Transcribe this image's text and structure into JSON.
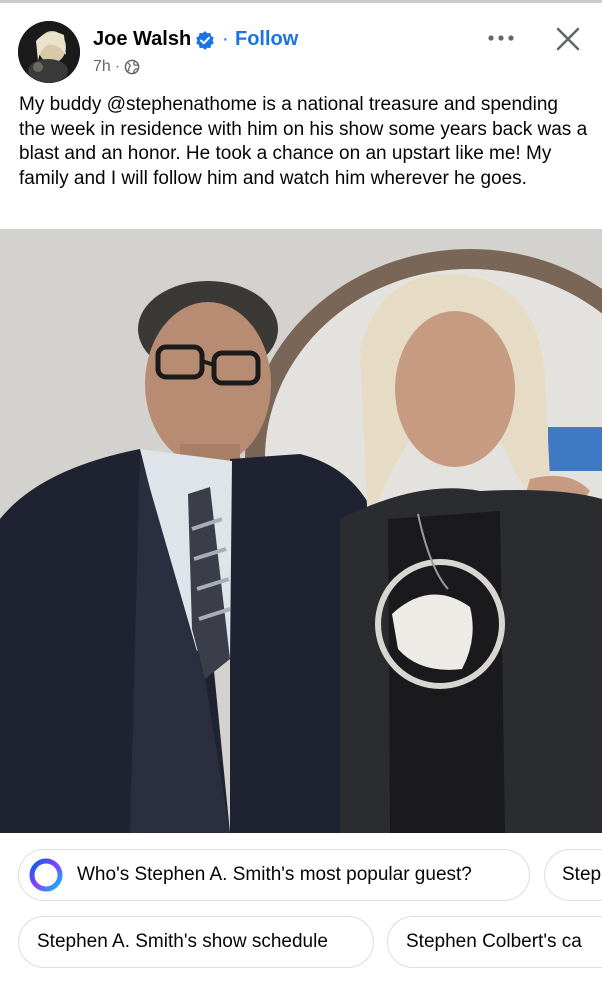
{
  "post": {
    "author": "Joe Walsh",
    "follow_label": "Follow",
    "separator": "·",
    "time": "7h",
    "time_separator": "·",
    "caption": "My buddy @stephenathome is a national treasure and spending the week in residence with him on his show some years back was a blast and an honor. He took a chance on an upstart like me! My family and I will follow him and watch him wherever he goes."
  },
  "icons": {
    "verified": "verified-badge-icon",
    "globe": "globe-icon",
    "more": "more-options-icon",
    "close": "close-icon"
  },
  "suggestions": [
    {
      "label": "Who's Stephen A. Smith's most popular guest?"
    },
    {
      "label": "Step"
    },
    {
      "label": "Stephen A. Smith's show schedule"
    },
    {
      "label": "Stephen Colbert's ca"
    }
  ],
  "colors": {
    "accent": "#1b74e4",
    "secondary_text": "#65676b",
    "chip_border": "#dcdde1"
  }
}
